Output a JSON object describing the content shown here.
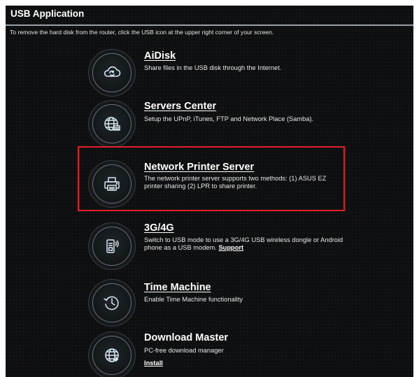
{
  "header": {
    "title": "USB Application",
    "notice": "To remove the hard disk from the router, click the USB icon at the upper right corner of your screen."
  },
  "apps": [
    {
      "title": "AiDisk",
      "description": "Share files in the USB disk through the Internet.",
      "icon": "cloud-sync-icon"
    },
    {
      "title": "Servers Center",
      "description": "Setup the UPnP, iTunes, FTP and Network Place (Samba).",
      "icon": "globe-server-icon"
    },
    {
      "title": "Network Printer Server",
      "description": "The network printer server supports two methods: (1) ASUS EZ printer sharing (2) LPR to share printer.",
      "icon": "printer-icon"
    },
    {
      "title": "3G/4G",
      "description": "Switch to USB mode to use a 3G/4G USB wireless dongle or Android phone as a USB modem.",
      "link": "Support",
      "icon": "usb-modem-icon"
    },
    {
      "title": "Time Machine",
      "description": "Enable Time Machine functionality",
      "icon": "time-machine-icon"
    },
    {
      "title": "Download Master",
      "description": "PC-free download manager",
      "link": "Install",
      "icon": "download-globe-icon"
    }
  ],
  "colors": {
    "panel_background": "#0e0f10",
    "highlight_border": "#e0202a",
    "icon_accent": "#cfe3f0"
  }
}
